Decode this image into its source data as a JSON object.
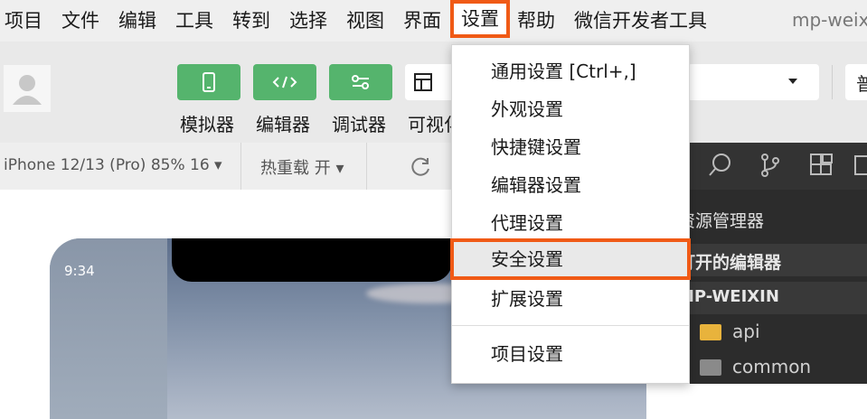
{
  "menubar": {
    "items": [
      "项目",
      "文件",
      "编辑",
      "工具",
      "转到",
      "选择",
      "视图",
      "界面",
      "设置",
      "帮助",
      "微信开发者工具"
    ],
    "active_index": 8,
    "app_title": "mp-weix"
  },
  "toolbar": {
    "buttons": [
      {
        "label": "模拟器",
        "icon": "phone-icon"
      },
      {
        "label": "编辑器",
        "icon": "code-icon"
      },
      {
        "label": "调试器",
        "icon": "debug-icon"
      },
      {
        "label": "可视化",
        "icon": "layout-icon"
      }
    ],
    "right_partial": "普"
  },
  "simbar": {
    "device": "iPhone 12/13 (Pro) 85% 16 ▾",
    "hot_reload": "热重载 开 ▾"
  },
  "simulator": {
    "time": "9:34"
  },
  "dropdown": {
    "items": [
      {
        "label": "通用设置  [Ctrl+,]"
      },
      {
        "label": "外观设置"
      },
      {
        "label": "快捷键设置"
      },
      {
        "label": "编辑器设置"
      },
      {
        "label": "代理设置"
      },
      {
        "label": "安全设置",
        "highlighted": true
      },
      {
        "label": "扩展设置"
      },
      {
        "label": "项目设置"
      }
    ]
  },
  "explorer": {
    "title": "资源管理器",
    "open_editors": "打开的编辑器",
    "project": "MP-WEIXIN",
    "files": [
      {
        "name": "api",
        "folder_color": "#e8b33c"
      },
      {
        "name": "common",
        "folder_color": "#8a8a8a"
      }
    ]
  },
  "colors": {
    "highlight": "#f05a16",
    "tool_green": "#55b46d",
    "panel_dark": "#2c2c2c"
  }
}
